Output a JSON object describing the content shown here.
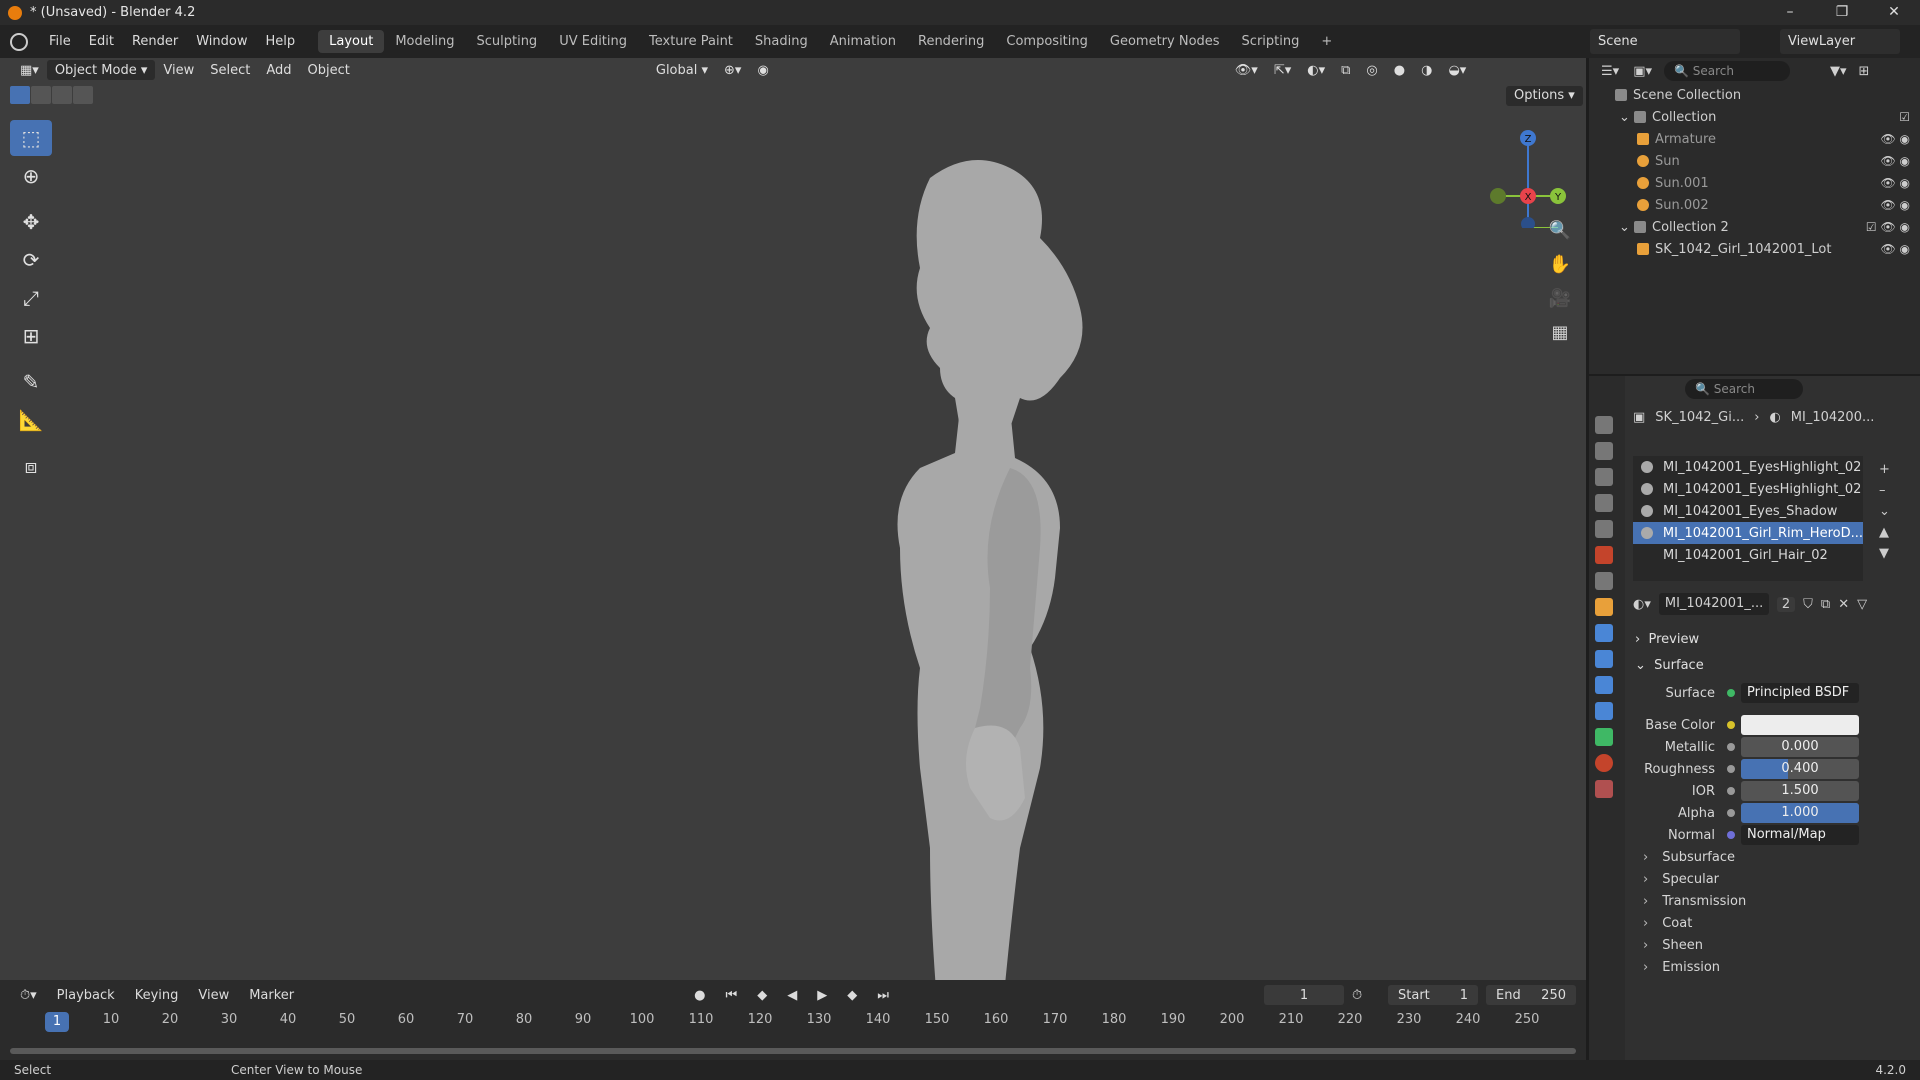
{
  "window": {
    "title": "* (Unsaved) - Blender 4.2"
  },
  "menu": [
    "File",
    "Edit",
    "Render",
    "Window",
    "Help"
  ],
  "workspaces": [
    "Layout",
    "Modeling",
    "Sculpting",
    "UV Editing",
    "Texture Paint",
    "Shading",
    "Animation",
    "Rendering",
    "Compositing",
    "Geometry Nodes",
    "Scripting"
  ],
  "scene": {
    "name": "Scene",
    "view_layer": "ViewLayer"
  },
  "viewport": {
    "mode": "Object Mode",
    "menus": [
      "View",
      "Select",
      "Add",
      "Object"
    ],
    "transform_orientation": "Global",
    "options_label": "Options",
    "gizmo": {
      "z": "Z",
      "y": "Y",
      "x": "X"
    }
  },
  "timeline": {
    "menus": [
      "Playback",
      "Keying",
      "View",
      "Marker"
    ],
    "current_frame": "1",
    "start_label": "Start",
    "start": "1",
    "end_label": "End",
    "end": "250",
    "ticks": [
      "10",
      "20",
      "30",
      "40",
      "50",
      "60",
      "70",
      "80",
      "90",
      "100",
      "110",
      "120",
      "130",
      "140",
      "150",
      "160",
      "170",
      "180",
      "190",
      "200",
      "210",
      "220",
      "230",
      "240",
      "250"
    ]
  },
  "status": {
    "left": "Select",
    "middle": "Center View to Mouse",
    "version": "4.2.0"
  },
  "outliner": {
    "search_placeholder": "Search",
    "root": "Scene Collection",
    "items": [
      {
        "name": "Collection",
        "level": 1
      },
      {
        "name": "Armature",
        "level": 2
      },
      {
        "name": "Sun",
        "level": 2
      },
      {
        "name": "Sun.001",
        "level": 2
      },
      {
        "name": "Sun.002",
        "level": 2
      },
      {
        "name": "Collection 2",
        "level": 1
      },
      {
        "name": "SK_1042_Girl_1042001_Lot",
        "level": 2
      }
    ]
  },
  "properties": {
    "search_placeholder": "Search",
    "breadcrumb_object": "SK_1042_Gi...",
    "breadcrumb_material": "MI_104200...",
    "materials": [
      "MI_1042001_EyesHighlight_02",
      "MI_1042001_EyesHighlight_02",
      "MI_1042001_Eyes_Shadow",
      "MI_1042001_Girl_Rim_HeroD...",
      "MI_1042001_Girl_Hair_02"
    ],
    "selected_material_index": 3,
    "active_material": "MI_1042001_...",
    "users": "2",
    "preview_label": "Preview",
    "surface_section": "Surface",
    "surface_label": "Surface",
    "surface_value": "Principled BSDF",
    "base_color_label": "Base Color",
    "metallic_label": "Metallic",
    "metallic": "0.000",
    "roughness_label": "Roughness",
    "roughness": "0.400",
    "roughness_fill": 0.4,
    "ior_label": "IOR",
    "ior": "1.500",
    "alpha_label": "Alpha",
    "alpha": "1.000",
    "alpha_fill": 1.0,
    "normal_label": "Normal",
    "normal_value": "Normal/Map",
    "subsections": [
      "Subsurface",
      "Specular",
      "Transmission",
      "Coat",
      "Sheen",
      "Emission"
    ]
  },
  "colors": {
    "accent": "#4772b3",
    "brand_orange": "#e87d0d",
    "axis_x": "#e8434b",
    "axis_y": "#8ac33b",
    "axis_z": "#3f78d0"
  }
}
